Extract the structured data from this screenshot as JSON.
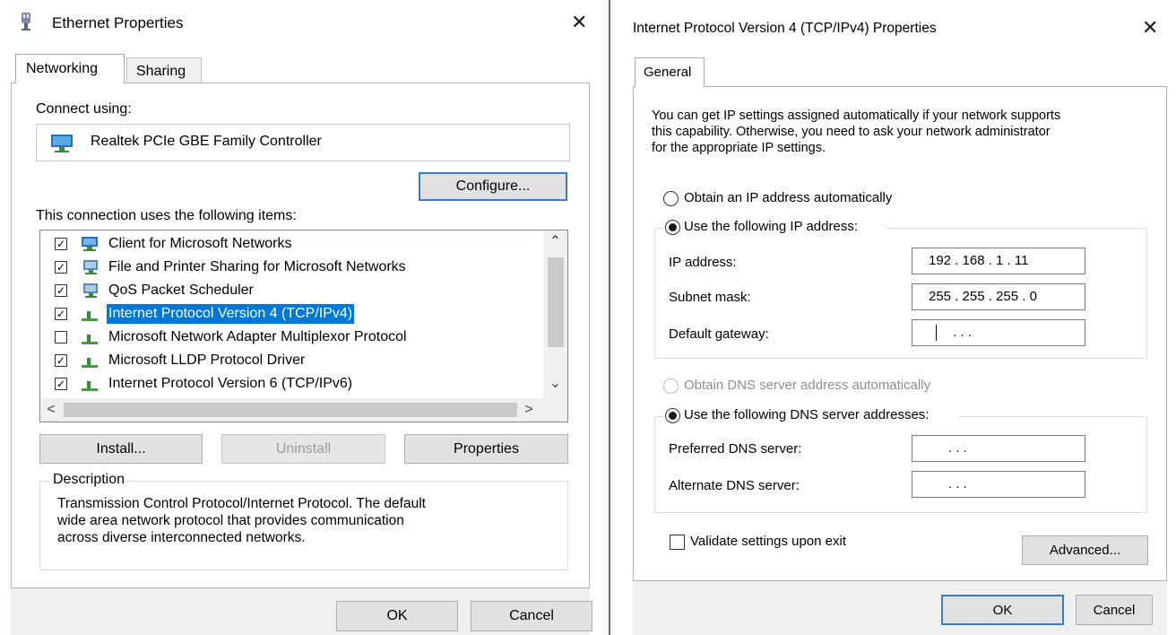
{
  "ethernet": {
    "title": "Ethernet Properties",
    "close_glyph": "✕",
    "tabs": [
      {
        "label": "Networking",
        "active": true
      },
      {
        "label": "Sharing",
        "active": false
      }
    ],
    "connect_using_label": "Connect using:",
    "adapter_name": "Realtek PCIe GBE Family Controller",
    "configure_label": "Configure...",
    "items_label": "This connection uses the following items:",
    "items": [
      {
        "label": "Client for Microsoft Networks",
        "checked": true,
        "icon": "network-client-icon"
      },
      {
        "label": "File and Printer Sharing for Microsoft Networks",
        "checked": true,
        "icon": "network-service-icon"
      },
      {
        "label": "QoS Packet Scheduler",
        "checked": true,
        "icon": "network-service-icon"
      },
      {
        "label": "Internet Protocol Version 4 (TCP/IPv4)",
        "checked": true,
        "icon": "protocol-icon",
        "selected": true
      },
      {
        "label": "Microsoft Network Adapter Multiplexor Protocol",
        "checked": false,
        "icon": "protocol-icon"
      },
      {
        "label": "Microsoft LLDP Protocol Driver",
        "checked": true,
        "icon": "protocol-icon"
      },
      {
        "label": "Internet Protocol Version 6 (TCP/IPv6)",
        "checked": true,
        "icon": "protocol-icon"
      }
    ],
    "scroll_up_glyph": "⌃",
    "scroll_down_glyph": "⌄",
    "scroll_left_glyph": "<",
    "scroll_right_glyph": ">",
    "install_label": "Install...",
    "uninstall_label": "Uninstall",
    "properties_label": "Properties",
    "description_legend": "Description",
    "description_lines": [
      "Transmission Control Protocol/Internet Protocol. The default",
      "wide area network protocol that provides communication",
      "across diverse interconnected networks."
    ],
    "ok_label": "OK",
    "cancel_label": "Cancel",
    "colors": {
      "selection": "#0078d7",
      "focus_border": "#3a7bc8"
    }
  },
  "ipv4": {
    "title": "Internet Protocol Version 4 (TCP/IPv4) Properties",
    "close_glyph": "✕",
    "tab_label": "General",
    "intro_lines": [
      "You can get IP settings assigned automatically if your network supports",
      "this capability. Otherwise, you need to ask your network administrator",
      "for the appropriate IP settings."
    ],
    "obtain_ip_label": "Obtain an IP address automatically",
    "use_ip_label": "Use the following IP address:",
    "ip_address_label": "IP address:",
    "ip_address_value": "192 . 168 .  1  .  11",
    "subnet_mask_label": "Subnet mask:",
    "subnet_mask_value": "255 . 255 . 255 .  0",
    "gateway_label": "Default gateway:",
    "gateway_value": " .       .       .",
    "obtain_dns_label": "Obtain DNS server address automatically",
    "use_dns_label": "Use the following DNS server addresses:",
    "preferred_dns_label": "Preferred DNS server:",
    "preferred_dns_value": "  .       .       .",
    "alternate_dns_label": "Alternate DNS server:",
    "alternate_dns_value": "  .       .       .",
    "validate_label": "Validate settings upon exit",
    "advanced_label": "Advanced...",
    "ok_label": "OK",
    "cancel_label": "Cancel",
    "ip_mode": "manual",
    "dns_mode": "manual",
    "validate_checked": false
  }
}
